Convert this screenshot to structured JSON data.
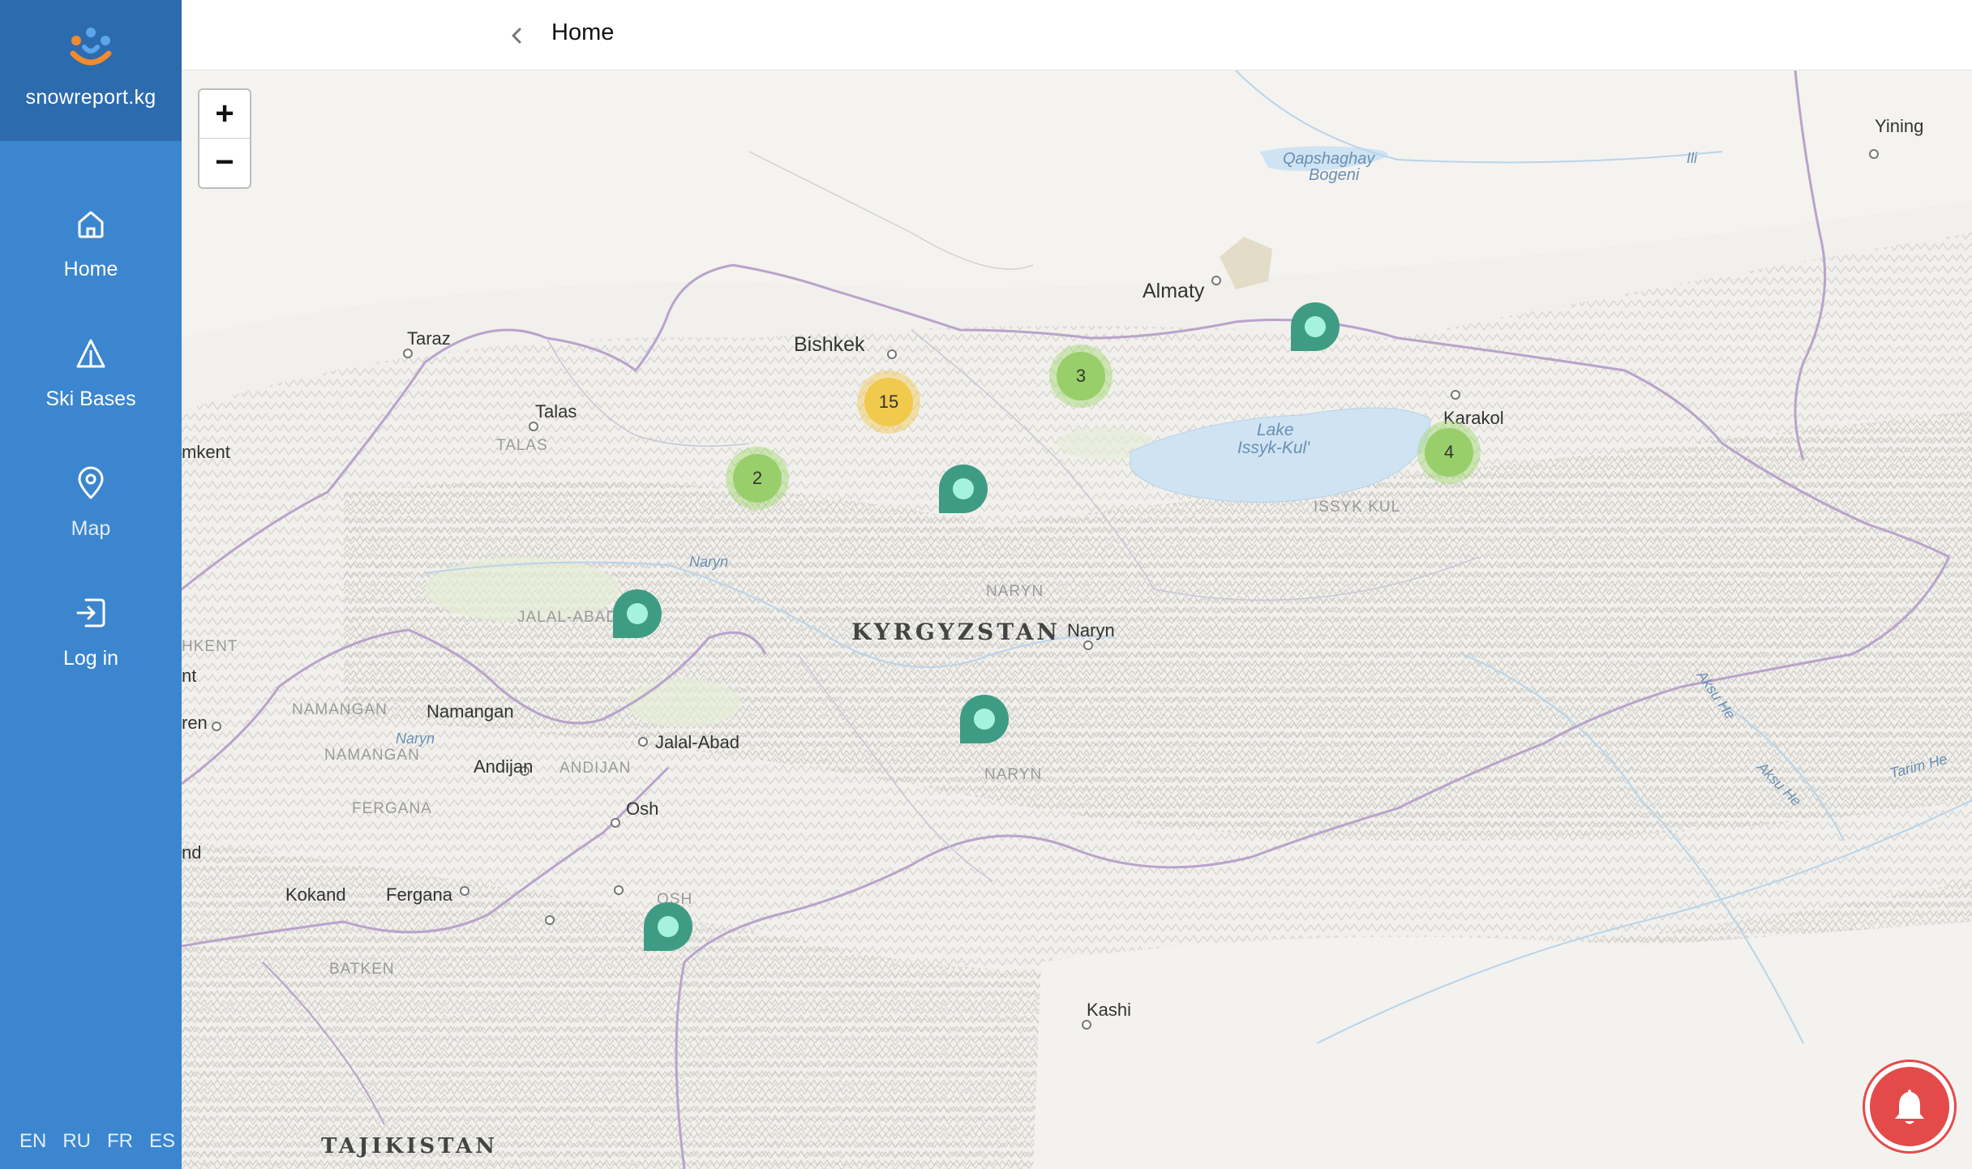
{
  "brand": {
    "name": "snowreport.kg"
  },
  "nav": {
    "items": [
      {
        "label": "Home",
        "icon": "home-icon"
      },
      {
        "label": "Ski Bases",
        "icon": "triangle-icon"
      },
      {
        "label": "Map",
        "icon": "map-pin-icon"
      },
      {
        "label": "Log in",
        "icon": "login-icon"
      }
    ]
  },
  "languages": [
    "EN",
    "RU",
    "FR",
    "ES"
  ],
  "header": {
    "title": "Home"
  },
  "map": {
    "zoom_in": "+",
    "zoom_out": "−",
    "labels": {
      "country": "KYRGYZSTAN",
      "tajikistan": "TAJIKISTAN",
      "bishkek": "Bishkek",
      "almaty": "Almaty",
      "taraz": "Taraz",
      "talas": "Talas",
      "talas_region": "TALAS",
      "karakol": "Karakol",
      "issyk_kul_region": "ISSYK KUL",
      "lake": "Lake",
      "lake2": "Issyk-Kul'",
      "naryn": "Naryn",
      "naryn_region": "NARYN",
      "naryn_region2": "NARYN",
      "jalal_abad": "Jalal-Abad",
      "jalal_abad_region": "JALAL-ABAD",
      "namangan": "Namangan",
      "namangan_region": "NAMANGAN",
      "namangan_region2": "NAMANGAN",
      "andijan": "Andijan",
      "andijan_region": "ANDIJAN",
      "osh": "Osh",
      "osh_region": "OSH",
      "fergana": "Fergana",
      "fergana_region": "FERGANA",
      "kokand": "Kokand",
      "batken": "BATKEN",
      "kashi": "Kashi",
      "yining": "Yining",
      "shymkent": "mkent",
      "tashkent": "HKENT",
      "nt": "nt",
      "ren": "ren",
      "nd": "nd",
      "kapchagay": "Qapshaghay",
      "kapchagay2": "Bogeni",
      "ili": "Ili",
      "naryn_river": "Naryn",
      "naryn_river2": "Naryn",
      "aksu": "Aksu He",
      "aksu2": "Aksu He",
      "tarim": "Tarim He"
    },
    "clusters": [
      {
        "count": "15",
        "color": "yellow"
      },
      {
        "count": "3",
        "color": "green"
      },
      {
        "count": "2",
        "color": "green"
      },
      {
        "count": "4",
        "color": "green"
      }
    ],
    "pin_color": "#3f9c84"
  }
}
